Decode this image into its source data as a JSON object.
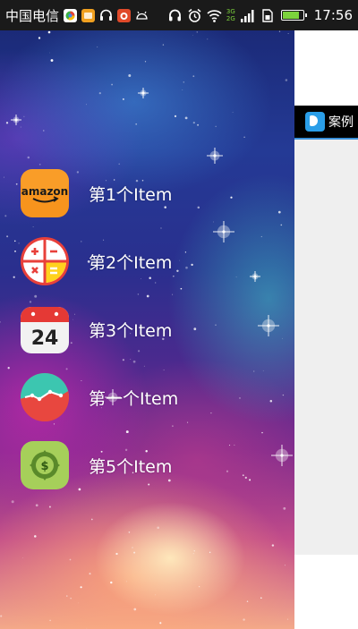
{
  "status_bar": {
    "carrier": "中国电信",
    "notification_icons": [
      "browser-icon",
      "app-icon",
      "headset-icon",
      "app-red-icon",
      "android-icon"
    ],
    "system_icons": [
      "headphones-icon",
      "alarm-icon",
      "wifi-icon",
      "signal-icon",
      "sim-icon",
      "battery-icon"
    ],
    "network_top": "3G",
    "network_bottom": "2G",
    "battery_level": 0.85,
    "time": "17:56"
  },
  "toolbar": {
    "title": "案例"
  },
  "drawer": {
    "items": [
      {
        "label": "第1个Item",
        "icon": "amazon-icon"
      },
      {
        "label": "第2个Item",
        "icon": "calculator-icon"
      },
      {
        "label": "第3个Item",
        "icon": "calendar-icon",
        "icon_text": "24"
      },
      {
        "label": "第一个Item",
        "icon": "chart-icon"
      },
      {
        "label": "第5个Item",
        "icon": "money-icon",
        "icon_text": "$"
      }
    ],
    "amazon_text": "amazon"
  },
  "colors": {
    "status_bar": "#1a1a1a",
    "toolbar": "#000000",
    "accent": "#3a8fd8",
    "battery": "#7cd23c"
  }
}
